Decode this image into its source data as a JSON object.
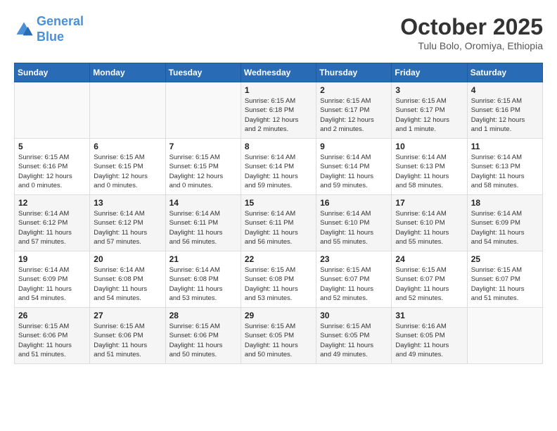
{
  "header": {
    "logo_line1": "General",
    "logo_line2": "Blue",
    "month": "October 2025",
    "location": "Tulu Bolo, Oromiya, Ethiopia"
  },
  "weekdays": [
    "Sunday",
    "Monday",
    "Tuesday",
    "Wednesday",
    "Thursday",
    "Friday",
    "Saturday"
  ],
  "weeks": [
    [
      {
        "day": "",
        "info": ""
      },
      {
        "day": "",
        "info": ""
      },
      {
        "day": "",
        "info": ""
      },
      {
        "day": "1",
        "info": "Sunrise: 6:15 AM\nSunset: 6:18 PM\nDaylight: 12 hours\nand 2 minutes."
      },
      {
        "day": "2",
        "info": "Sunrise: 6:15 AM\nSunset: 6:17 PM\nDaylight: 12 hours\nand 2 minutes."
      },
      {
        "day": "3",
        "info": "Sunrise: 6:15 AM\nSunset: 6:17 PM\nDaylight: 12 hours\nand 1 minute."
      },
      {
        "day": "4",
        "info": "Sunrise: 6:15 AM\nSunset: 6:16 PM\nDaylight: 12 hours\nand 1 minute."
      }
    ],
    [
      {
        "day": "5",
        "info": "Sunrise: 6:15 AM\nSunset: 6:16 PM\nDaylight: 12 hours\nand 0 minutes."
      },
      {
        "day": "6",
        "info": "Sunrise: 6:15 AM\nSunset: 6:15 PM\nDaylight: 12 hours\nand 0 minutes."
      },
      {
        "day": "7",
        "info": "Sunrise: 6:15 AM\nSunset: 6:15 PM\nDaylight: 12 hours\nand 0 minutes."
      },
      {
        "day": "8",
        "info": "Sunrise: 6:14 AM\nSunset: 6:14 PM\nDaylight: 11 hours\nand 59 minutes."
      },
      {
        "day": "9",
        "info": "Sunrise: 6:14 AM\nSunset: 6:14 PM\nDaylight: 11 hours\nand 59 minutes."
      },
      {
        "day": "10",
        "info": "Sunrise: 6:14 AM\nSunset: 6:13 PM\nDaylight: 11 hours\nand 58 minutes."
      },
      {
        "day": "11",
        "info": "Sunrise: 6:14 AM\nSunset: 6:13 PM\nDaylight: 11 hours\nand 58 minutes."
      }
    ],
    [
      {
        "day": "12",
        "info": "Sunrise: 6:14 AM\nSunset: 6:12 PM\nDaylight: 11 hours\nand 57 minutes."
      },
      {
        "day": "13",
        "info": "Sunrise: 6:14 AM\nSunset: 6:12 PM\nDaylight: 11 hours\nand 57 minutes."
      },
      {
        "day": "14",
        "info": "Sunrise: 6:14 AM\nSunset: 6:11 PM\nDaylight: 11 hours\nand 56 minutes."
      },
      {
        "day": "15",
        "info": "Sunrise: 6:14 AM\nSunset: 6:11 PM\nDaylight: 11 hours\nand 56 minutes."
      },
      {
        "day": "16",
        "info": "Sunrise: 6:14 AM\nSunset: 6:10 PM\nDaylight: 11 hours\nand 55 minutes."
      },
      {
        "day": "17",
        "info": "Sunrise: 6:14 AM\nSunset: 6:10 PM\nDaylight: 11 hours\nand 55 minutes."
      },
      {
        "day": "18",
        "info": "Sunrise: 6:14 AM\nSunset: 6:09 PM\nDaylight: 11 hours\nand 54 minutes."
      }
    ],
    [
      {
        "day": "19",
        "info": "Sunrise: 6:14 AM\nSunset: 6:09 PM\nDaylight: 11 hours\nand 54 minutes."
      },
      {
        "day": "20",
        "info": "Sunrise: 6:14 AM\nSunset: 6:08 PM\nDaylight: 11 hours\nand 54 minutes."
      },
      {
        "day": "21",
        "info": "Sunrise: 6:14 AM\nSunset: 6:08 PM\nDaylight: 11 hours\nand 53 minutes."
      },
      {
        "day": "22",
        "info": "Sunrise: 6:15 AM\nSunset: 6:08 PM\nDaylight: 11 hours\nand 53 minutes."
      },
      {
        "day": "23",
        "info": "Sunrise: 6:15 AM\nSunset: 6:07 PM\nDaylight: 11 hours\nand 52 minutes."
      },
      {
        "day": "24",
        "info": "Sunrise: 6:15 AM\nSunset: 6:07 PM\nDaylight: 11 hours\nand 52 minutes."
      },
      {
        "day": "25",
        "info": "Sunrise: 6:15 AM\nSunset: 6:07 PM\nDaylight: 11 hours\nand 51 minutes."
      }
    ],
    [
      {
        "day": "26",
        "info": "Sunrise: 6:15 AM\nSunset: 6:06 PM\nDaylight: 11 hours\nand 51 minutes."
      },
      {
        "day": "27",
        "info": "Sunrise: 6:15 AM\nSunset: 6:06 PM\nDaylight: 11 hours\nand 51 minutes."
      },
      {
        "day": "28",
        "info": "Sunrise: 6:15 AM\nSunset: 6:06 PM\nDaylight: 11 hours\nand 50 minutes."
      },
      {
        "day": "29",
        "info": "Sunrise: 6:15 AM\nSunset: 6:05 PM\nDaylight: 11 hours\nand 50 minutes."
      },
      {
        "day": "30",
        "info": "Sunrise: 6:15 AM\nSunset: 6:05 PM\nDaylight: 11 hours\nand 49 minutes."
      },
      {
        "day": "31",
        "info": "Sunrise: 6:16 AM\nSunset: 6:05 PM\nDaylight: 11 hours\nand 49 minutes."
      },
      {
        "day": "",
        "info": ""
      }
    ]
  ]
}
